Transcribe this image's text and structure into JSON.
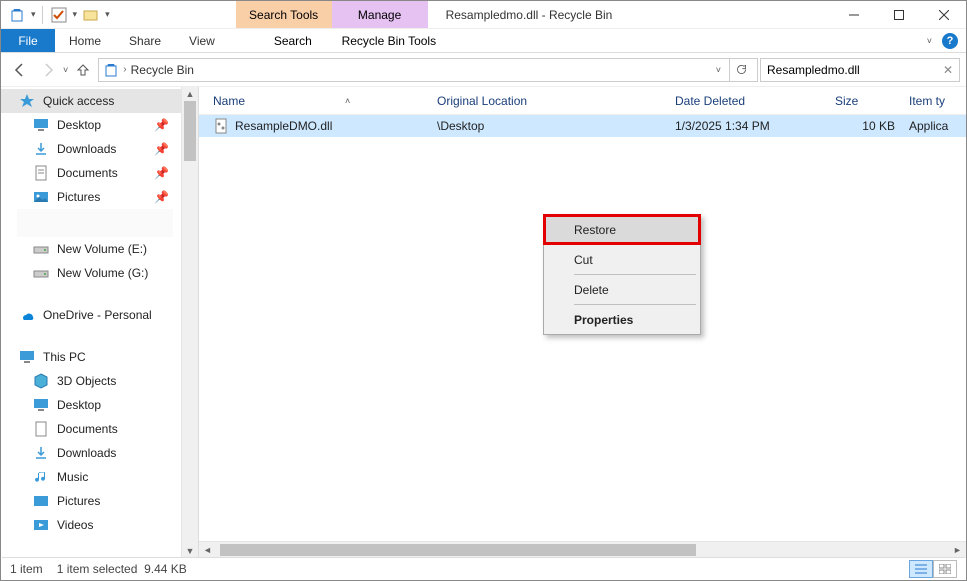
{
  "title": "Resampledmo.dll - Recycle Bin",
  "ribbon": {
    "context_tabs": {
      "search": "Search Tools",
      "manage": "Manage"
    },
    "file": "File",
    "tabs": {
      "home": "Home",
      "share": "Share",
      "view": "View"
    },
    "sub_tabs": {
      "search": "Search",
      "rbt": "Recycle Bin Tools"
    }
  },
  "breadcrumb": {
    "location": "Recycle Bin"
  },
  "search": {
    "value": "Resampledmo.dll"
  },
  "sidebar": {
    "quick_access": "Quick access",
    "desktop": "Desktop",
    "downloads": "Downloads",
    "documents": "Documents",
    "pictures": "Pictures",
    "newvol_e": "New Volume (E:)",
    "newvol_g": "New Volume (G:)",
    "onedrive": "OneDrive - Personal",
    "thispc": "This PC",
    "objects3d": "3D Objects",
    "pc_desktop": "Desktop",
    "pc_documents": "Documents",
    "pc_downloads": "Downloads",
    "pc_music": "Music",
    "pc_pictures": "Pictures",
    "pc_videos": "Videos"
  },
  "columns": {
    "name": "Name",
    "orig": "Original Location",
    "date": "Date Deleted",
    "size": "Size",
    "type": "Item ty"
  },
  "file": {
    "name": "ResampleDMO.dll",
    "orig_suffix": "\\Desktop",
    "date": "1/3/2025 1:34 PM",
    "size": "10 KB",
    "type": "Applica"
  },
  "context_menu": {
    "restore": "Restore",
    "cut": "Cut",
    "delete": "Delete",
    "properties": "Properties"
  },
  "status": {
    "count": "1 item",
    "selected": "1 item selected",
    "size": "9.44 KB"
  }
}
